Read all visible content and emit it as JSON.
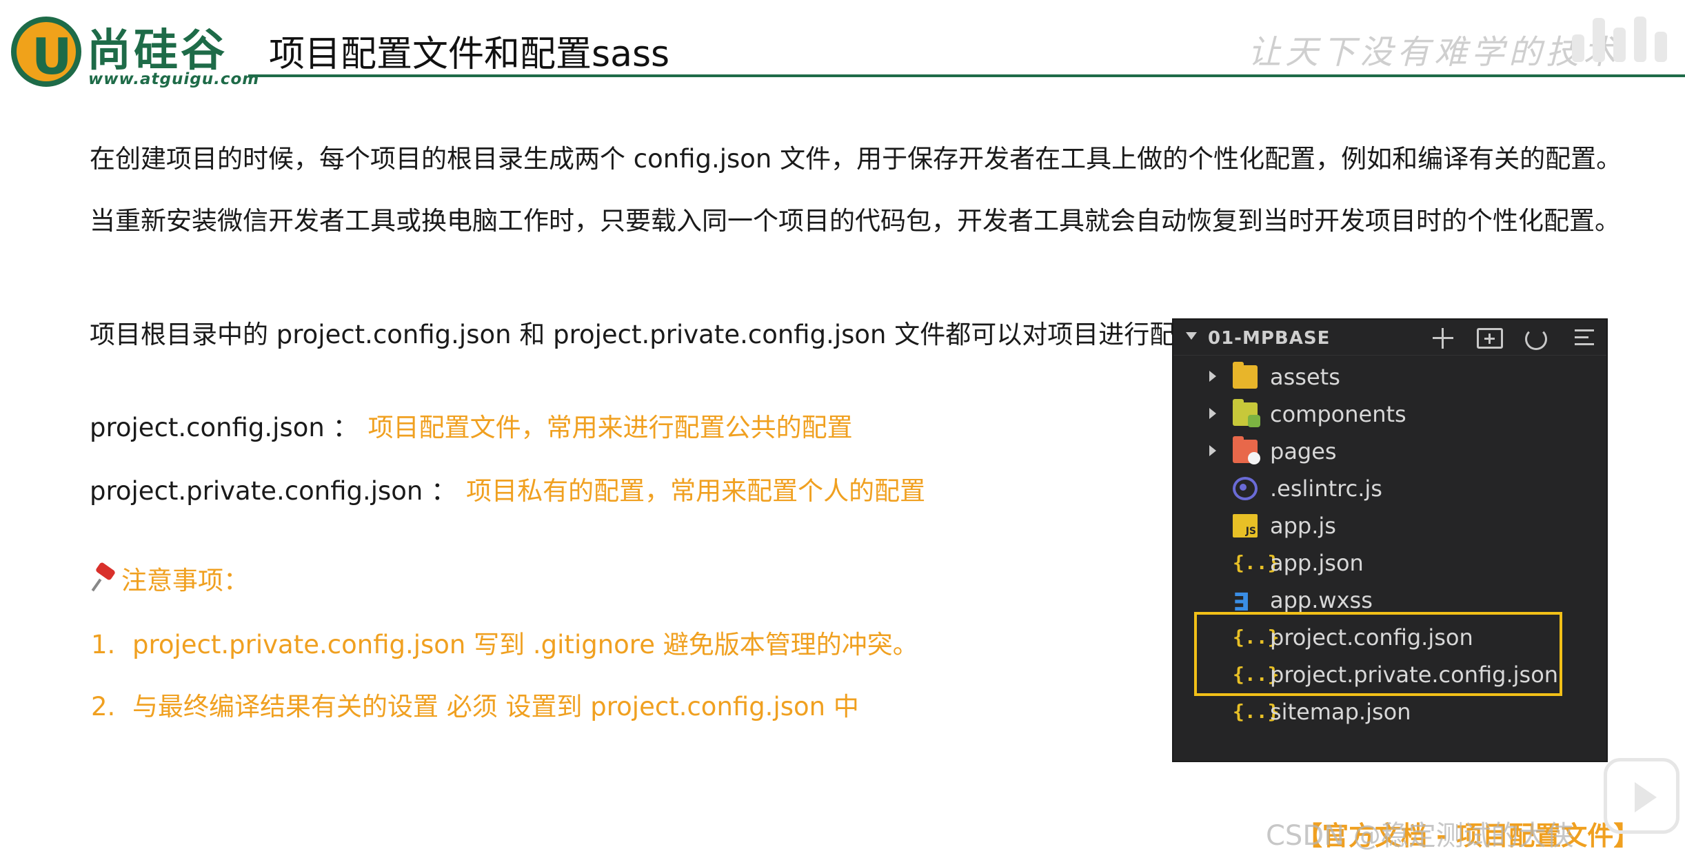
{
  "header": {
    "logo_text": "尚硅谷",
    "logo_url": "www.atguigu.com",
    "title": "项目配置文件和配置sass",
    "slogan": "让天下没有难学的技术"
  },
  "body": {
    "paragraph1": "在创建项目的时候，每个项目的根目录生成两个 config.json 文件，用于保存开发者在工具上做的个性化配置，例如和编译有关的配置。",
    "paragraph2": "当重新安装微信开发者工具或换电脑工作时，只要载入同一个项目的代码包，开发者工具就会自动恢复到当时开发项目时的个性化配置。",
    "paragraph3": "项目根目录中的 project.config.json 和 project.private.config.json 文件都可以对项目进行配置",
    "configs": [
      {
        "key": "project.config.json ：",
        "value": "项目配置文件，常用来进行配置公共的配置"
      },
      {
        "key": "project.private.config.json ：",
        "value": "项目私有的配置，常用来配置个人的配置"
      }
    ],
    "notes_title": "注意事项：",
    "notes": [
      {
        "num": "1.",
        "text": "project.private.config.json 写到 .gitignore 避免版本管理的冲突。"
      },
      {
        "num": "2.",
        "text": "与最终编译结果有关的设置 必须 设置到 project.config.json 中"
      }
    ]
  },
  "explorer": {
    "title": "01-MPBASE",
    "items": [
      {
        "label": "assets",
        "icon": "folder-icon"
      },
      {
        "label": "components",
        "icon": "folder-components-icon"
      },
      {
        "label": "pages",
        "icon": "folder-pages-icon"
      },
      {
        "label": ".eslintrc.js",
        "icon": "eslint-icon"
      },
      {
        "label": "app.js",
        "icon": "js-file-icon"
      },
      {
        "label": "app.json",
        "icon": "json-file-icon"
      },
      {
        "label": "app.wxss",
        "icon": "css-file-icon"
      },
      {
        "label": "project.config.json",
        "icon": "json-file-icon"
      },
      {
        "label": "project.private.config.json",
        "icon": "json-file-icon"
      },
      {
        "label": "sitemap.json",
        "icon": "json-file-icon"
      }
    ],
    "json_glyph": "{..}",
    "js_glyph": "JS"
  },
  "footer": {
    "link": "【官方文档 - 项目配置文件】",
    "watermark": "CSDN @稳定测试的大侠"
  },
  "colors": {
    "brand_green": "#1e6b48",
    "accent_orange": "#f0a020",
    "highlight_yellow": "#f2c018",
    "panel_bg": "#252526"
  }
}
